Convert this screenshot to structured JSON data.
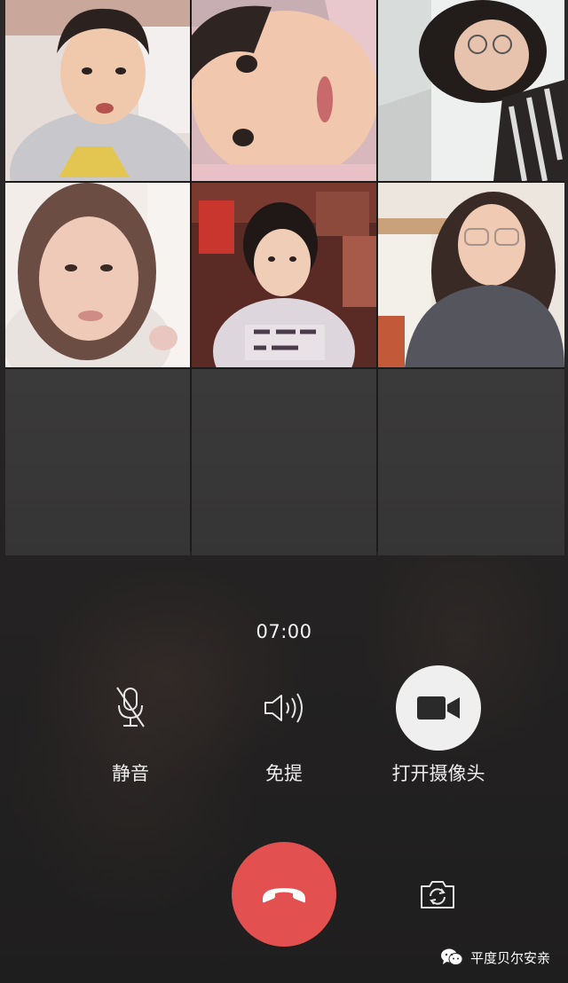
{
  "call": {
    "timer": "07:00",
    "participant_count": 6
  },
  "participants": [
    {
      "tile": "video-1",
      "video_on": true
    },
    {
      "tile": "video-2",
      "video_on": true
    },
    {
      "tile": "video-3",
      "video_on": true
    },
    {
      "tile": "video-4",
      "video_on": true
    },
    {
      "tile": "video-5",
      "video_on": true
    },
    {
      "tile": "video-6",
      "video_on": true
    }
  ],
  "controls": {
    "mute": {
      "label": "静音",
      "icon": "microphone-muted-icon"
    },
    "speaker": {
      "label": "免提",
      "icon": "speaker-icon"
    },
    "camera": {
      "label": "打开摄像头",
      "icon": "video-camera-icon"
    },
    "hangup": {
      "icon": "hang-up-icon",
      "color": "#e35050"
    },
    "switch_camera": {
      "icon": "switch-camera-icon"
    }
  },
  "watermark": {
    "text": "平度贝尔安亲",
    "icon": "wechat-logo-icon"
  },
  "colors": {
    "background": "#262626",
    "hangup": "#e35050",
    "camera_button": "#efefef"
  }
}
